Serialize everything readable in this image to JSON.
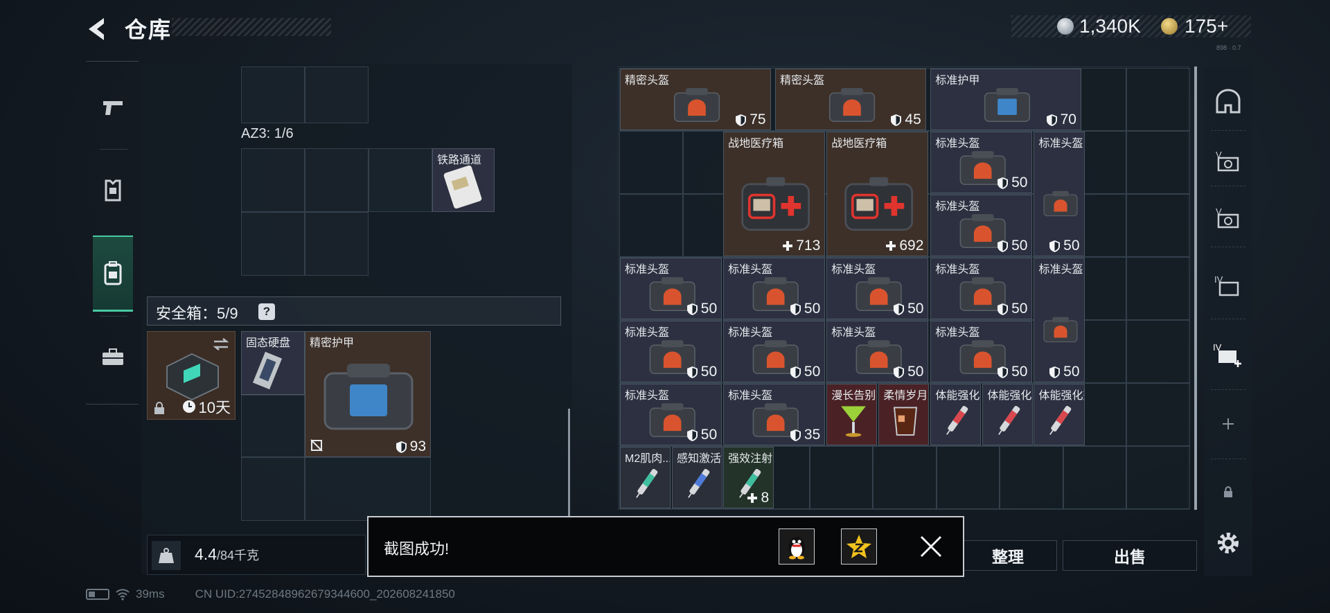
{
  "header": {
    "title": "仓库",
    "currency": [
      {
        "icon": "silver-coin-icon",
        "value": "1,340K"
      },
      {
        "icon": "gold-coin-icon",
        "value": "175+"
      }
    ],
    "tiny_label": "898 · 0.7"
  },
  "left_rail": {
    "tabs": [
      {
        "icon": "pistol-icon",
        "active": false
      },
      {
        "icon": "armor-vest-icon",
        "active": false
      },
      {
        "icon": "backpack-icon",
        "active": true
      },
      {
        "icon": "briefcase-icon",
        "active": false
      }
    ]
  },
  "left_panel": {
    "az_label": "AZ3: 1/6",
    "railway_item": {
      "name": "铁路通道"
    },
    "safe_box": {
      "label": "安全箱：5/9",
      "help": "?"
    },
    "case_item": {
      "time": "10天"
    },
    "safe_items": [
      {
        "name": "固态硬盘"
      },
      {
        "name": "精密护甲",
        "value": "93"
      }
    ],
    "weight": {
      "current": "4.4",
      "max": "/84千克"
    }
  },
  "inventory": [
    {
      "name": "精密头盔",
      "value": "75",
      "kind": "shield",
      "bg": "brown"
    },
    {
      "name": "精密头盔",
      "value": "45",
      "kind": "shield",
      "bg": "brown"
    },
    {
      "name": "标准护甲",
      "value": "70",
      "kind": "shield",
      "bg": "slate"
    },
    {
      "name": "战地医疗箱",
      "value": "713",
      "kind": "cross",
      "bg": "brown"
    },
    {
      "name": "战地医疗箱",
      "value": "692",
      "kind": "cross",
      "bg": "brown"
    },
    {
      "name": "标准头盔",
      "value": "50",
      "kind": "shield",
      "bg": "slate"
    },
    {
      "name": "标准头盔",
      "value": "50",
      "kind": "shield",
      "bg": "slate"
    },
    {
      "name": "标准头盔",
      "value": "50",
      "kind": "shield",
      "bg": "slate"
    },
    {
      "name": "标准头盔",
      "value": "50",
      "kind": "shield",
      "bg": "slate"
    },
    {
      "name": "标准头盔",
      "value": "50",
      "kind": "shield",
      "bg": "slate"
    },
    {
      "name": "标准头盔",
      "value": "50",
      "kind": "shield",
      "bg": "slate"
    },
    {
      "name": "标准头盔",
      "value": "50",
      "kind": "shield",
      "bg": "slate"
    },
    {
      "name": "标准头盔",
      "value": "50",
      "kind": "shield",
      "bg": "slate"
    },
    {
      "name": "标准头盔",
      "value": "50",
      "kind": "shield",
      "bg": "slate"
    },
    {
      "name": "标准头盔",
      "value": "50",
      "kind": "shield",
      "bg": "slate"
    },
    {
      "name": "标准头盔",
      "value": "50",
      "kind": "shield",
      "bg": "slate"
    },
    {
      "name": "标准头盔",
      "value": "50",
      "kind": "shield",
      "bg": "slate"
    },
    {
      "name": "标准头盔",
      "value": "50",
      "kind": "shield",
      "bg": "slate"
    },
    {
      "name": "标准头盔",
      "value": "35",
      "kind": "shield",
      "bg": "slate"
    },
    {
      "name": "漫长告别",
      "value": "",
      "kind": "none",
      "bg": "red"
    },
    {
      "name": "柔情岁月",
      "value": "",
      "kind": "none",
      "bg": "red"
    },
    {
      "name": "体能强化剂",
      "value": "",
      "kind": "none",
      "bg": "slate"
    },
    {
      "name": "体能强化剂",
      "value": "",
      "kind": "none",
      "bg": "slate"
    },
    {
      "name": "体能强化剂",
      "value": "",
      "kind": "none",
      "bg": "slate"
    },
    {
      "name": "M2肌肉...",
      "value": "",
      "kind": "none",
      "bg": "dark"
    },
    {
      "name": "感知激活针",
      "value": "",
      "kind": "none",
      "bg": "dark"
    },
    {
      "name": "强效注射器",
      "value": "8",
      "kind": "cross",
      "bg": "green"
    }
  ],
  "right_rail": {
    "items": [
      {
        "icon": "helmet-slot-icon"
      },
      {
        "icon": "v-storage-icon-1"
      },
      {
        "icon": "v-storage-icon-2"
      },
      {
        "icon": "iv-storage-icon"
      },
      {
        "icon": "iv-add-storage-icon"
      },
      {
        "icon": "add-icon"
      },
      {
        "icon": "lock-icon"
      }
    ]
  },
  "actions": {
    "sort": "整理",
    "sell": "出售"
  },
  "toast": {
    "message": "截图成功!"
  },
  "footer": {
    "ping": "39ms",
    "uid": "CN UID:27452848962679344600_202608241850"
  }
}
